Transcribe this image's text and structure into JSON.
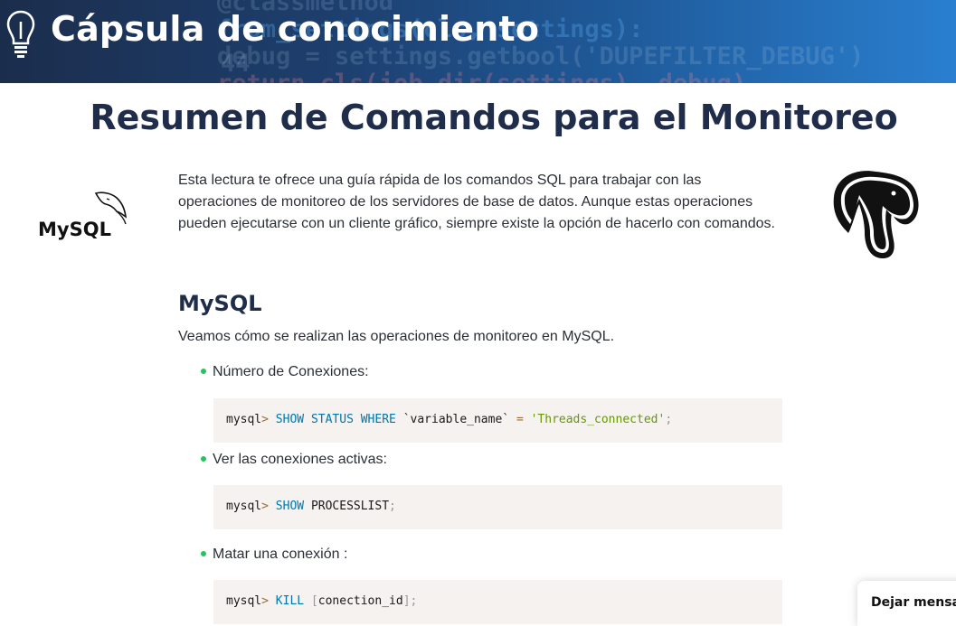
{
  "banner": {
    "title": "Cápsula de conocimiento",
    "background_code": {
      "line1": "@classmethod",
      "line2": "from_settings(cls, settings):",
      "line3": "debug = settings.getbool('DUPEFILTER_DEBUG')",
      "line4": "return cls(job_dir(settings), debug)",
      "line_numbers": [
        "44"
      ]
    }
  },
  "page": {
    "title": "Resumen de Comandos para el Monitoreo",
    "intro": "Esta lectura te ofrece una guía rápida de los comandos SQL para trabajar con las operaciones de monitoreo de los servidores de base de datos. Aunque estas operaciones pueden ejecutarse con un cliente gráfico, siempre existe la opción de hacerlo con comandos.",
    "mysql_logo_text": "MySQL"
  },
  "mysql_section": {
    "title": "MySQL",
    "subtitle": "Veamos cómo se realizan las operaciones de monitoreo en MySQL.",
    "items": [
      {
        "label": "Número de Conexiones:",
        "code": {
          "prompt": "mysql",
          "arrow": ">",
          "kw1": "SHOW",
          "kw2": "STATUS",
          "kw3": "WHERE",
          "ident": "`variable_name`",
          "op": "=",
          "string": "'Threads_connected'",
          "end": ";"
        }
      },
      {
        "label": "Ver las conexiones activas:",
        "code": {
          "prompt": "mysql",
          "arrow": ">",
          "kw1": "SHOW",
          "plain": "PROCESSLIST",
          "end": ";"
        }
      },
      {
        "label": "Matar una conexión :",
        "code": {
          "prompt": "mysql",
          "arrow": ">",
          "kw1": "KILL",
          "open": "[",
          "plain": "conection_id",
          "close": "]",
          "end": ";"
        }
      }
    ]
  },
  "chat": {
    "label": "Dejar mensaje"
  },
  "colors": {
    "title": "#1f2d4a",
    "bullet": "#22c55e",
    "code_bg": "#f5f2f0",
    "keyword": "#0077aa",
    "string": "#669900"
  }
}
